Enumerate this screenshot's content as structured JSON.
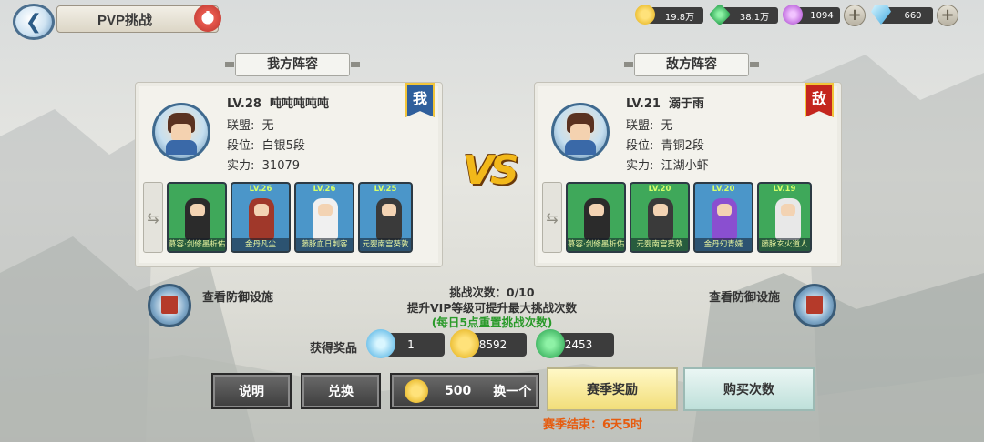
{
  "header": {
    "title": "PVP挑战",
    "back_icon": "back-arrow-icon",
    "alert_icon": "alert-icon"
  },
  "resources": [
    {
      "icon": "gold-coin-icon",
      "value": "19.8万",
      "color": "#f5c518"
    },
    {
      "icon": "jade-icon",
      "value": "38.1万",
      "color": "#2fb35a"
    },
    {
      "icon": "spirit-orb-icon",
      "value": "1094",
      "color": "#c76be0"
    },
    {
      "icon": "diamond-icon",
      "value": "660",
      "color": "#5bc3ee"
    }
  ],
  "my_team": {
    "tag": "我方阵容",
    "badge": "我",
    "badge_color": "#2f5f9c",
    "level": "LV.28",
    "name": "吨吨吨吨吨",
    "alliance_label": "联盟:",
    "alliance": "无",
    "rank_label": "段位:",
    "rank": "白银5段",
    "power_label": "实力:",
    "power": "31079",
    "heroes": [
      {
        "lv": "",
        "name": "慕容·剑修墨析佑",
        "bg": "#3fa85a",
        "robe": "#2b2b2b"
      },
      {
        "lv": "LV.26",
        "name": "金丹凡尘",
        "bg": "#4b96c9",
        "robe": "#a0382a"
      },
      {
        "lv": "LV.26",
        "name": "藤脉血日刺客",
        "bg": "#4b96c9",
        "robe": "#f0f0f0"
      },
      {
        "lv": "LV.25",
        "name": "元婴南宫葵敦",
        "bg": "#4b96c9",
        "robe": "#3a3a3a"
      }
    ]
  },
  "enemy_team": {
    "tag": "敌方阵容",
    "badge": "敌",
    "badge_color": "#c4261e",
    "level": "LV.21",
    "name": "溺于雨",
    "alliance_label": "联盟:",
    "alliance": "无",
    "rank_label": "段位:",
    "rank": "青铜2段",
    "power_label": "实力:",
    "power": "江湖小虾",
    "heroes": [
      {
        "lv": "",
        "name": "慕容·剑修墨析佑",
        "bg": "#3fa85a",
        "robe": "#2b2b2b"
      },
      {
        "lv": "LV.20",
        "name": "元婴南宫葵敦",
        "bg": "#3fa85a",
        "robe": "#3a3a3a"
      },
      {
        "lv": "LV.20",
        "name": "金丹幻青婕",
        "bg": "#4b96c9",
        "robe": "#8a4fd0"
      },
      {
        "lv": "LV.19",
        "name": "藤脉玄火道人",
        "bg": "#3fa85a",
        "robe": "#e8e8e8"
      }
    ]
  },
  "vs_text": "VS",
  "defense_label": "查看防御设施",
  "challenge": {
    "count_text": "挑战次数：0/10",
    "vip_hint": "提升VIP等级可提升最大挑战次数",
    "reset_hint": "(每日5点重置挑战次数)"
  },
  "rewards": {
    "label": "获得奖品",
    "items": [
      {
        "icon": "diamond-icon",
        "value": "1",
        "color": "#5bc3ee"
      },
      {
        "icon": "gold-coin-icon",
        "value": "8592",
        "color": "#f5c518"
      },
      {
        "icon": "jade-icon",
        "value": "2453",
        "color": "#2fb35a"
      }
    ]
  },
  "buttons": {
    "explain": "说明",
    "exchange": "兑换",
    "refresh_cost": "500",
    "refresh_label": "换一个",
    "season_reward": "赛季奖励",
    "buy_times": "购买次数"
  },
  "season_end": "赛季结束：6天5时"
}
